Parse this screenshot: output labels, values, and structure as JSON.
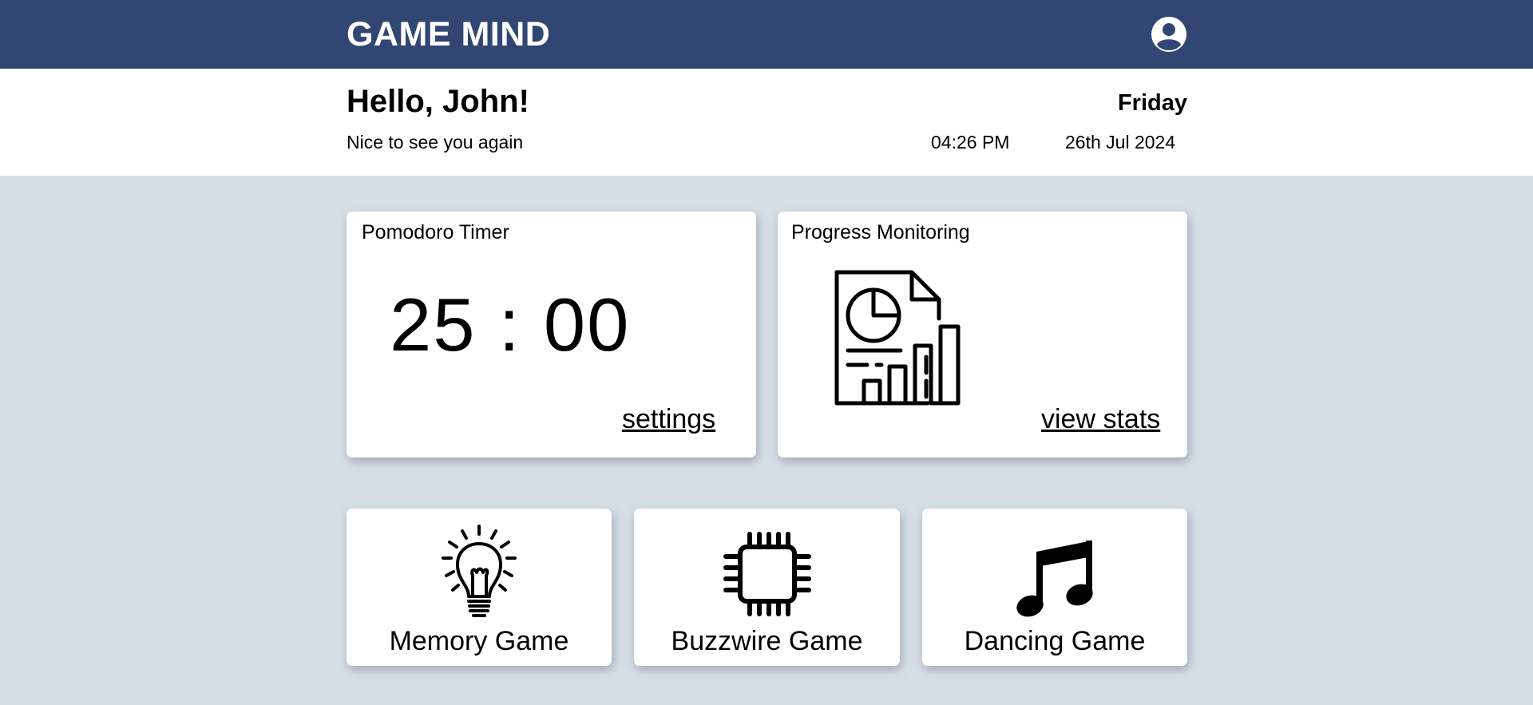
{
  "header": {
    "brand": "GAME MIND",
    "account_icon": "account-circle-icon"
  },
  "greeting": {
    "title": "Hello, John!",
    "subtitle": "Nice to see you again",
    "weekday": "Friday",
    "time": "04:26 PM",
    "date": "26th Jul 2024"
  },
  "pomodoro": {
    "title": "Pomodoro Timer",
    "timer": "25 : 00",
    "settings_link": "settings"
  },
  "progress": {
    "title": "Progress Monitoring",
    "icon": "report-chart-icon",
    "stats_link": "view stats"
  },
  "games": [
    {
      "label": "Memory Game",
      "icon": "lightbulb-icon"
    },
    {
      "label": "Buzzwire Game",
      "icon": "microchip-icon"
    },
    {
      "label": "Dancing Game",
      "icon": "music-note-icon"
    }
  ],
  "colors": {
    "header_bg": "#314673",
    "page_bg": "#d6dfe6",
    "card_bg": "#ffffff"
  }
}
